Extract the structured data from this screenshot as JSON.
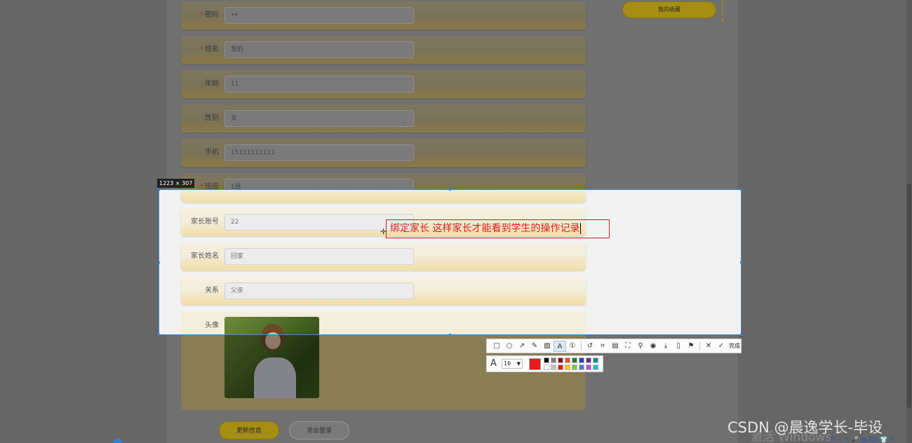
{
  "form": {
    "rows": [
      {
        "label": "密码",
        "required": true,
        "value": "••"
      },
      {
        "label": "姓名",
        "required": true,
        "value": "发的"
      },
      {
        "label": "年龄",
        "required": false,
        "value": "11"
      },
      {
        "label": "性别",
        "required": false,
        "value": "女"
      },
      {
        "label": "手机",
        "required": false,
        "value": "15111111111"
      },
      {
        "label": "班级",
        "required": true,
        "value": "1班"
      },
      {
        "label": "家长账号",
        "required": false,
        "value": "22"
      },
      {
        "label": "家长姓名",
        "required": false,
        "value": "回家"
      },
      {
        "label": "关系",
        "required": false,
        "value": "父亲"
      }
    ],
    "required_mark": "*",
    "avatar_label": "头像",
    "update_button": "更新信息",
    "logout_button": "退出登录"
  },
  "sidebar_right": {
    "favorites_button": "我的收藏"
  },
  "capture_tool": {
    "size_tag": "1223 × 307",
    "annotation_text": "绑定家长 这样家长才能看到学生的操作记录",
    "annotation_color": "#d82020",
    "tools": [
      "rectangle-icon",
      "ellipse-icon",
      "arrow-icon",
      "pencil-icon",
      "mosaic-icon",
      "text-icon",
      "number-icon",
      "undo-icon",
      "crop-icon",
      "ocr-icon",
      "fullscreen-icon",
      "pin-icon",
      "record-icon",
      "download-icon",
      "save-icon",
      "bookmark-icon",
      "close-icon"
    ],
    "finish_label": "完成",
    "font_size": "16",
    "current_color": "#e81b1b",
    "palette": [
      "#000000",
      "#7f7f7f",
      "#880015",
      "#e8521b",
      "#1e7b2e",
      "#2b3fa8",
      "#6b2c91",
      "#0f8f8f",
      "#ffffff",
      "#c3c3c3",
      "#e81b1b",
      "#ffc90e",
      "#8bc34a",
      "#3f7fe8",
      "#c04fd0",
      "#20c0d0"
    ]
  },
  "watermark": {
    "csdn": "CSDN @晨逸学长-毕设",
    "activate": "激活 Windows",
    "tray": "中 ·, ⚲ 🎤 ▦ ⌨ 👕 ⊞"
  }
}
